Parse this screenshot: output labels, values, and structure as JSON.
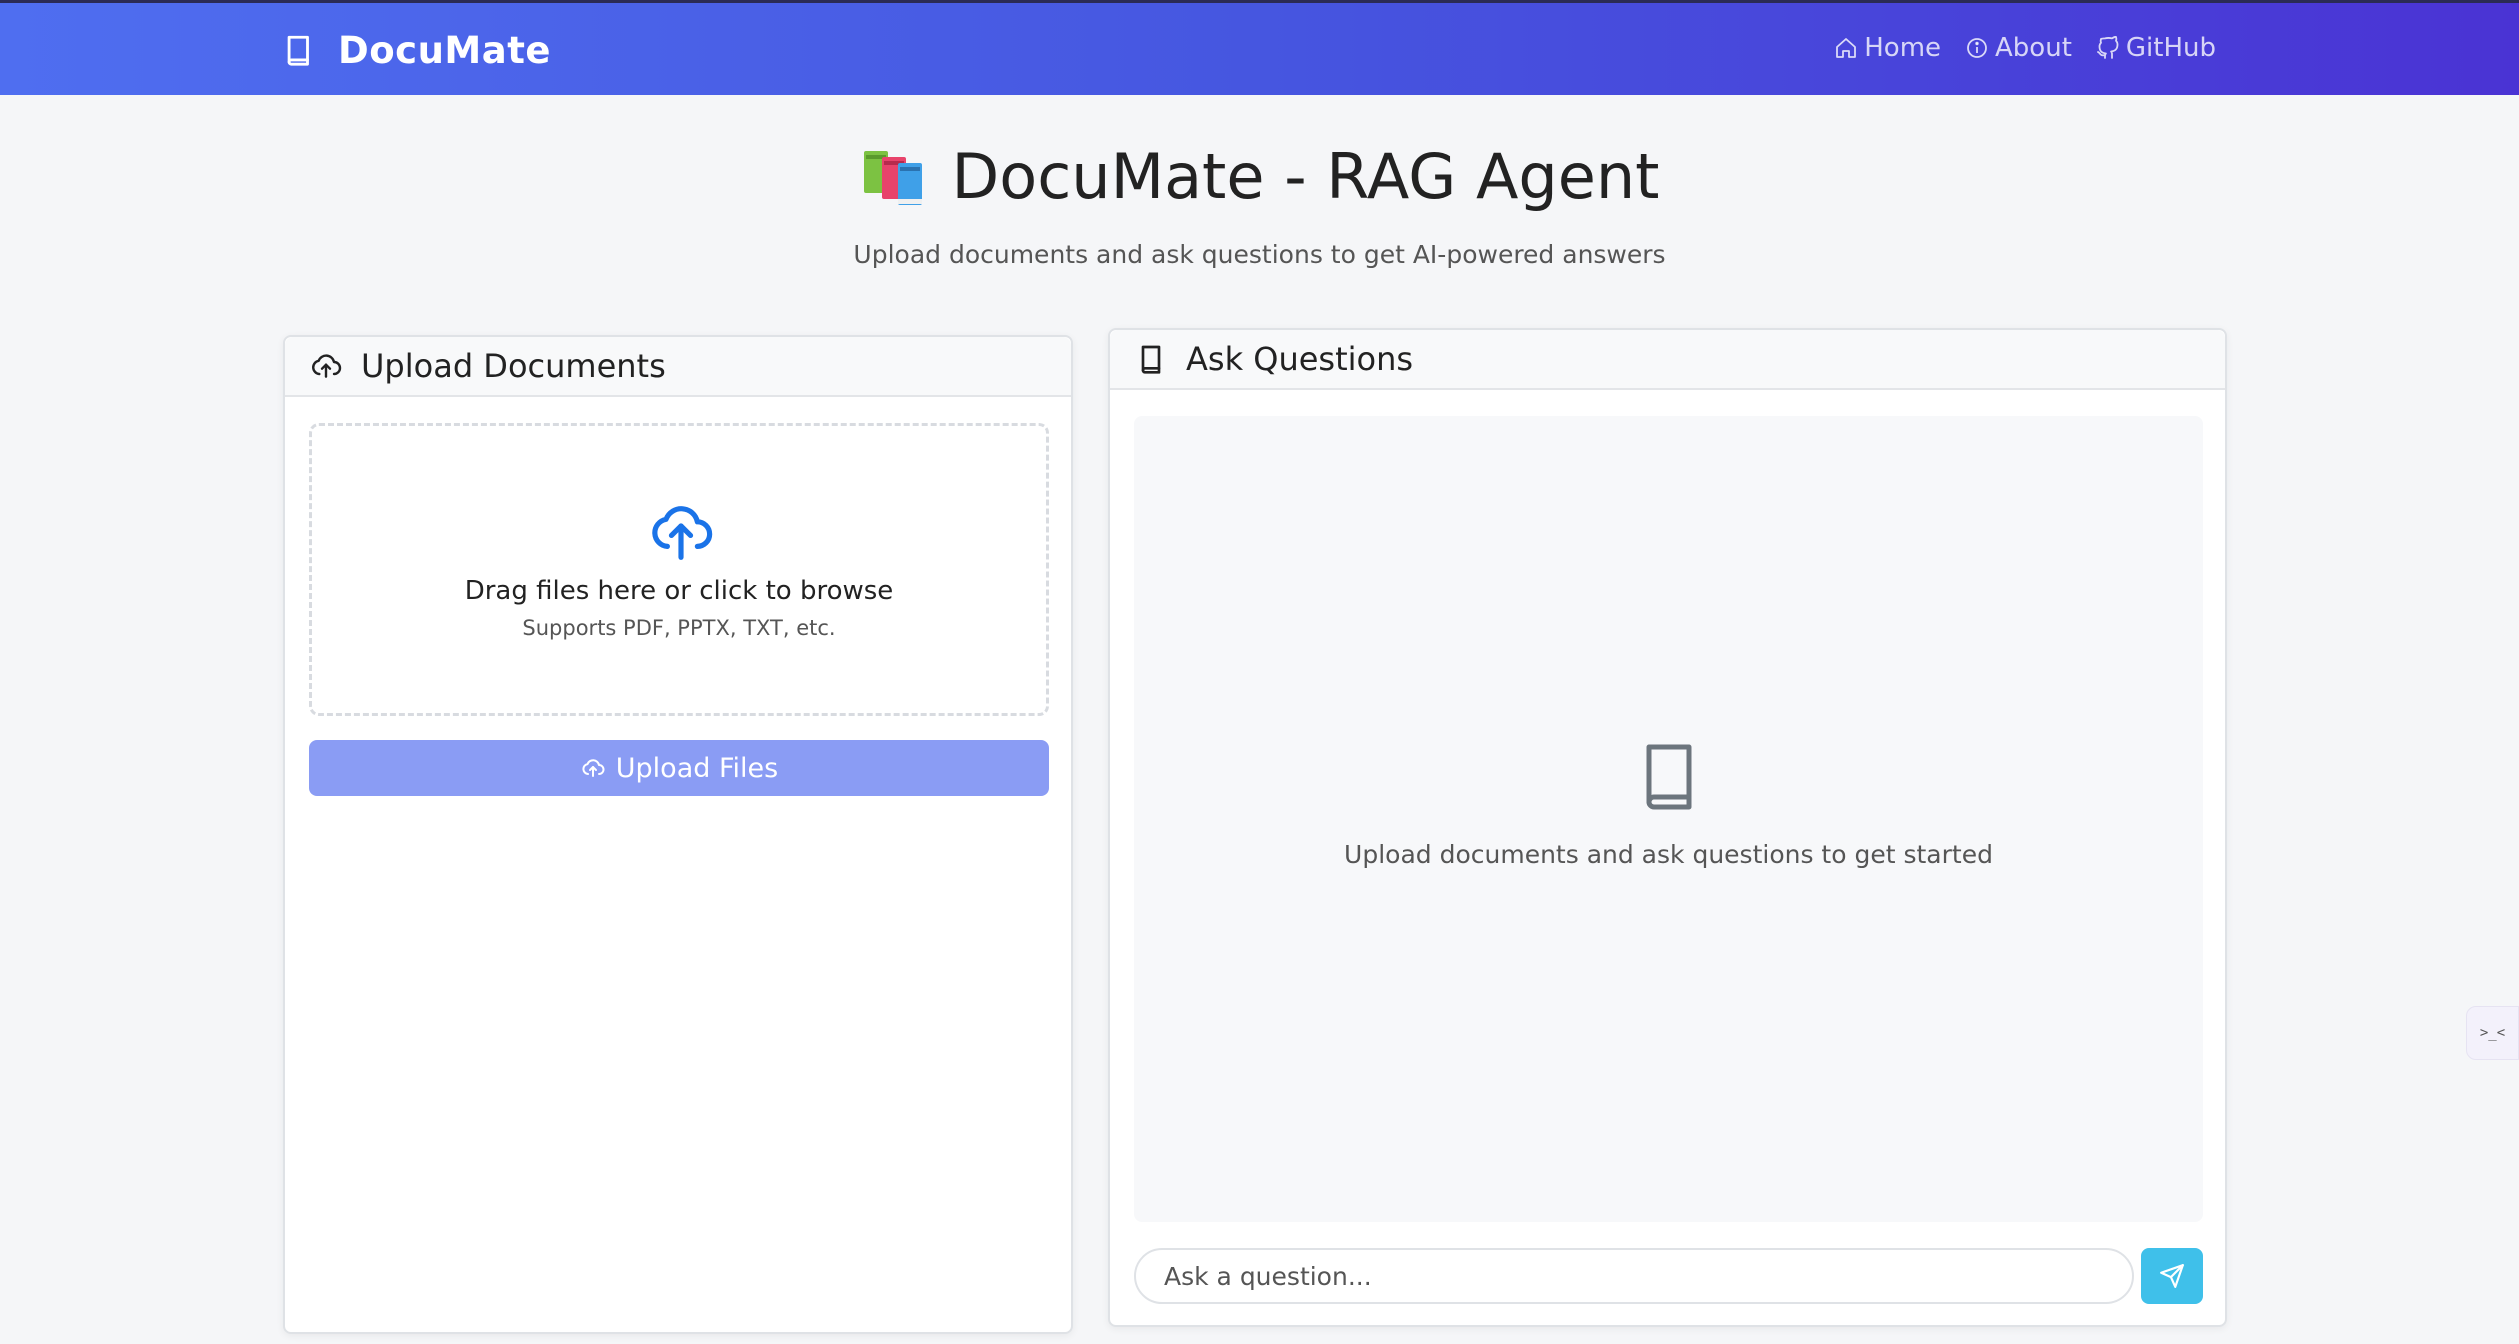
{
  "navbar": {
    "brand": "DocuMate",
    "brand_icon": "book-icon",
    "links": [
      {
        "label": "Home",
        "icon": "home-icon"
      },
      {
        "label": "About",
        "icon": "info-icon"
      },
      {
        "label": "GitHub",
        "icon": "github-icon"
      }
    ]
  },
  "hero": {
    "title": "DocuMate - RAG Agent",
    "title_icon": "books-emoji-icon",
    "subtitle": "Upload documents and ask questions to get AI-powered answers"
  },
  "upload": {
    "title": "Upload Documents",
    "title_icon": "cloud-upload-icon",
    "dropzone_main": "Drag files here or click to browse",
    "dropzone_sub": "Supports PDF, PPTX, TXT, etc.",
    "button_label": "Upload Files"
  },
  "ask": {
    "title": "Ask Questions",
    "title_icon": "book-icon",
    "empty_text": "Upload documents and ask questions to get started",
    "input_placeholder": "Ask a question...",
    "send_icon": "send-icon"
  },
  "side_widget": {
    "glyph": ">_<"
  },
  "colors": {
    "navbar_start": "#4f6ef0",
    "navbar_end": "#4a33d4",
    "upload_button": "#8a9cf4",
    "send_button": "#3fc0ea",
    "accent_icon": "#1a73e8"
  }
}
